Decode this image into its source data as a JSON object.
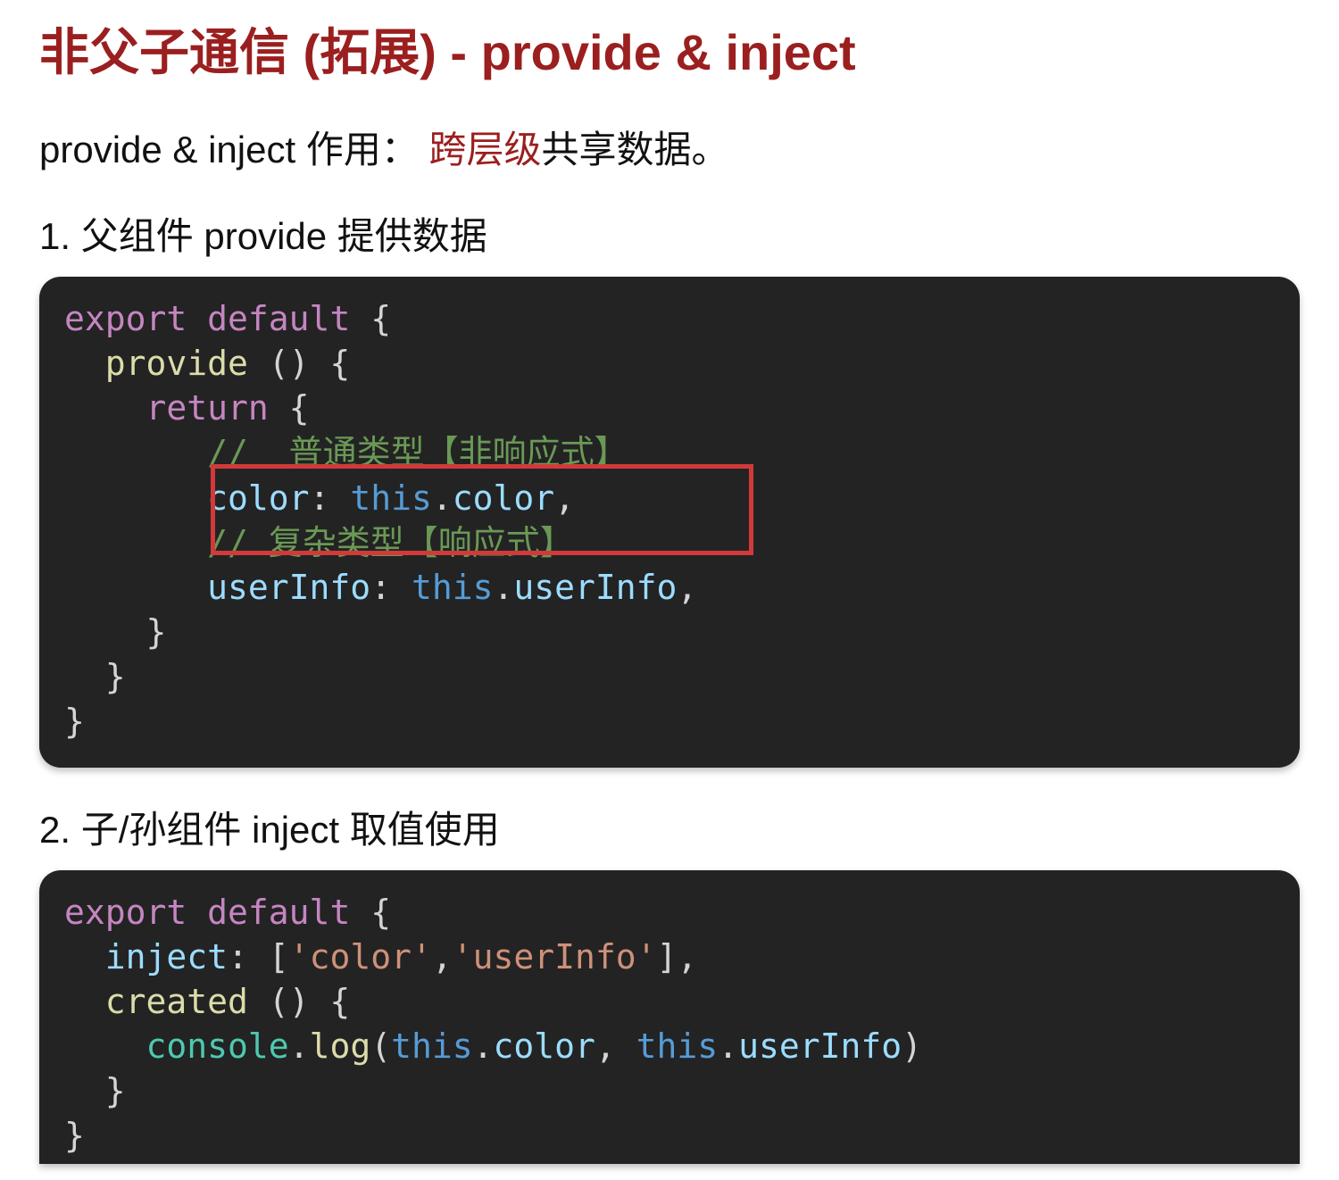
{
  "title": {
    "prefix": "非父子通信 (拓展) - ",
    "suffix": "provide & inject"
  },
  "intro": {
    "lead": "provide & inject 作用： ",
    "highlight": "跨层级",
    "trail": "共享数据。"
  },
  "step1": "1. 父组件 provide 提供数据",
  "step2": "2. 子/孙组件 inject 取值使用",
  "code1": {
    "l1_kw1": "export",
    "l1_kw2": "default",
    "l1_brace": " {",
    "l2_ind": "  ",
    "l2_name": "provide",
    "l2_rest": " () {",
    "l3_ind": "    ",
    "l3_kw": "return",
    "l3_rest": " {",
    "l4_ind": "       ",
    "l4_slashes": "// ",
    "l4_text": " 普通类型【非响应式】",
    "l5_ind": "       ",
    "l5_key": "color",
    "l5_colon": ": ",
    "l5_this": "this",
    "l5_dot": ".",
    "l5_attr": "color",
    "l5_comma": ",",
    "l6_ind": "       ",
    "l6_slashes": "// ",
    "l6_text": "复杂类型【响应式】",
    "l7_ind": "       ",
    "l7_key": "userInfo",
    "l7_colon": ": ",
    "l7_this": "this",
    "l7_dot": ".",
    "l7_attr": "userInfo",
    "l7_comma": ",",
    "l8_ind": "    ",
    "l8_brace": "}",
    "l9_ind": "  ",
    "l9_brace": "}",
    "l10_brace": "}"
  },
  "code2": {
    "l1_kw1": "export",
    "l1_kw2": "default",
    "l1_brace": " {",
    "l2_ind": "  ",
    "l2_key": "inject",
    "l2_colon": ": [",
    "l2_s1": "'color'",
    "l2_comma": ",",
    "l2_s2": "'userInfo'",
    "l2_close": "],",
    "l3_ind": "  ",
    "l3_name": "created",
    "l3_rest": " () {",
    "l4_ind": "    ",
    "l4_obj": "console",
    "l4_dot1": ".",
    "l4_fn": "log",
    "l4_open": "(",
    "l4_this1": "this",
    "l4_dot2": ".",
    "l4_attr1": "color",
    "l4_comma": ", ",
    "l4_this2": "this",
    "l4_dot3": ".",
    "l4_attr2": "userInfo",
    "l4_close": ")",
    "l5_ind": "  ",
    "l5_brace": "}",
    "l6_brace": "}"
  },
  "colors": {
    "title_red": "#9b1f1f",
    "code_bg": "#232324",
    "highlight_border": "#d23a3a"
  }
}
